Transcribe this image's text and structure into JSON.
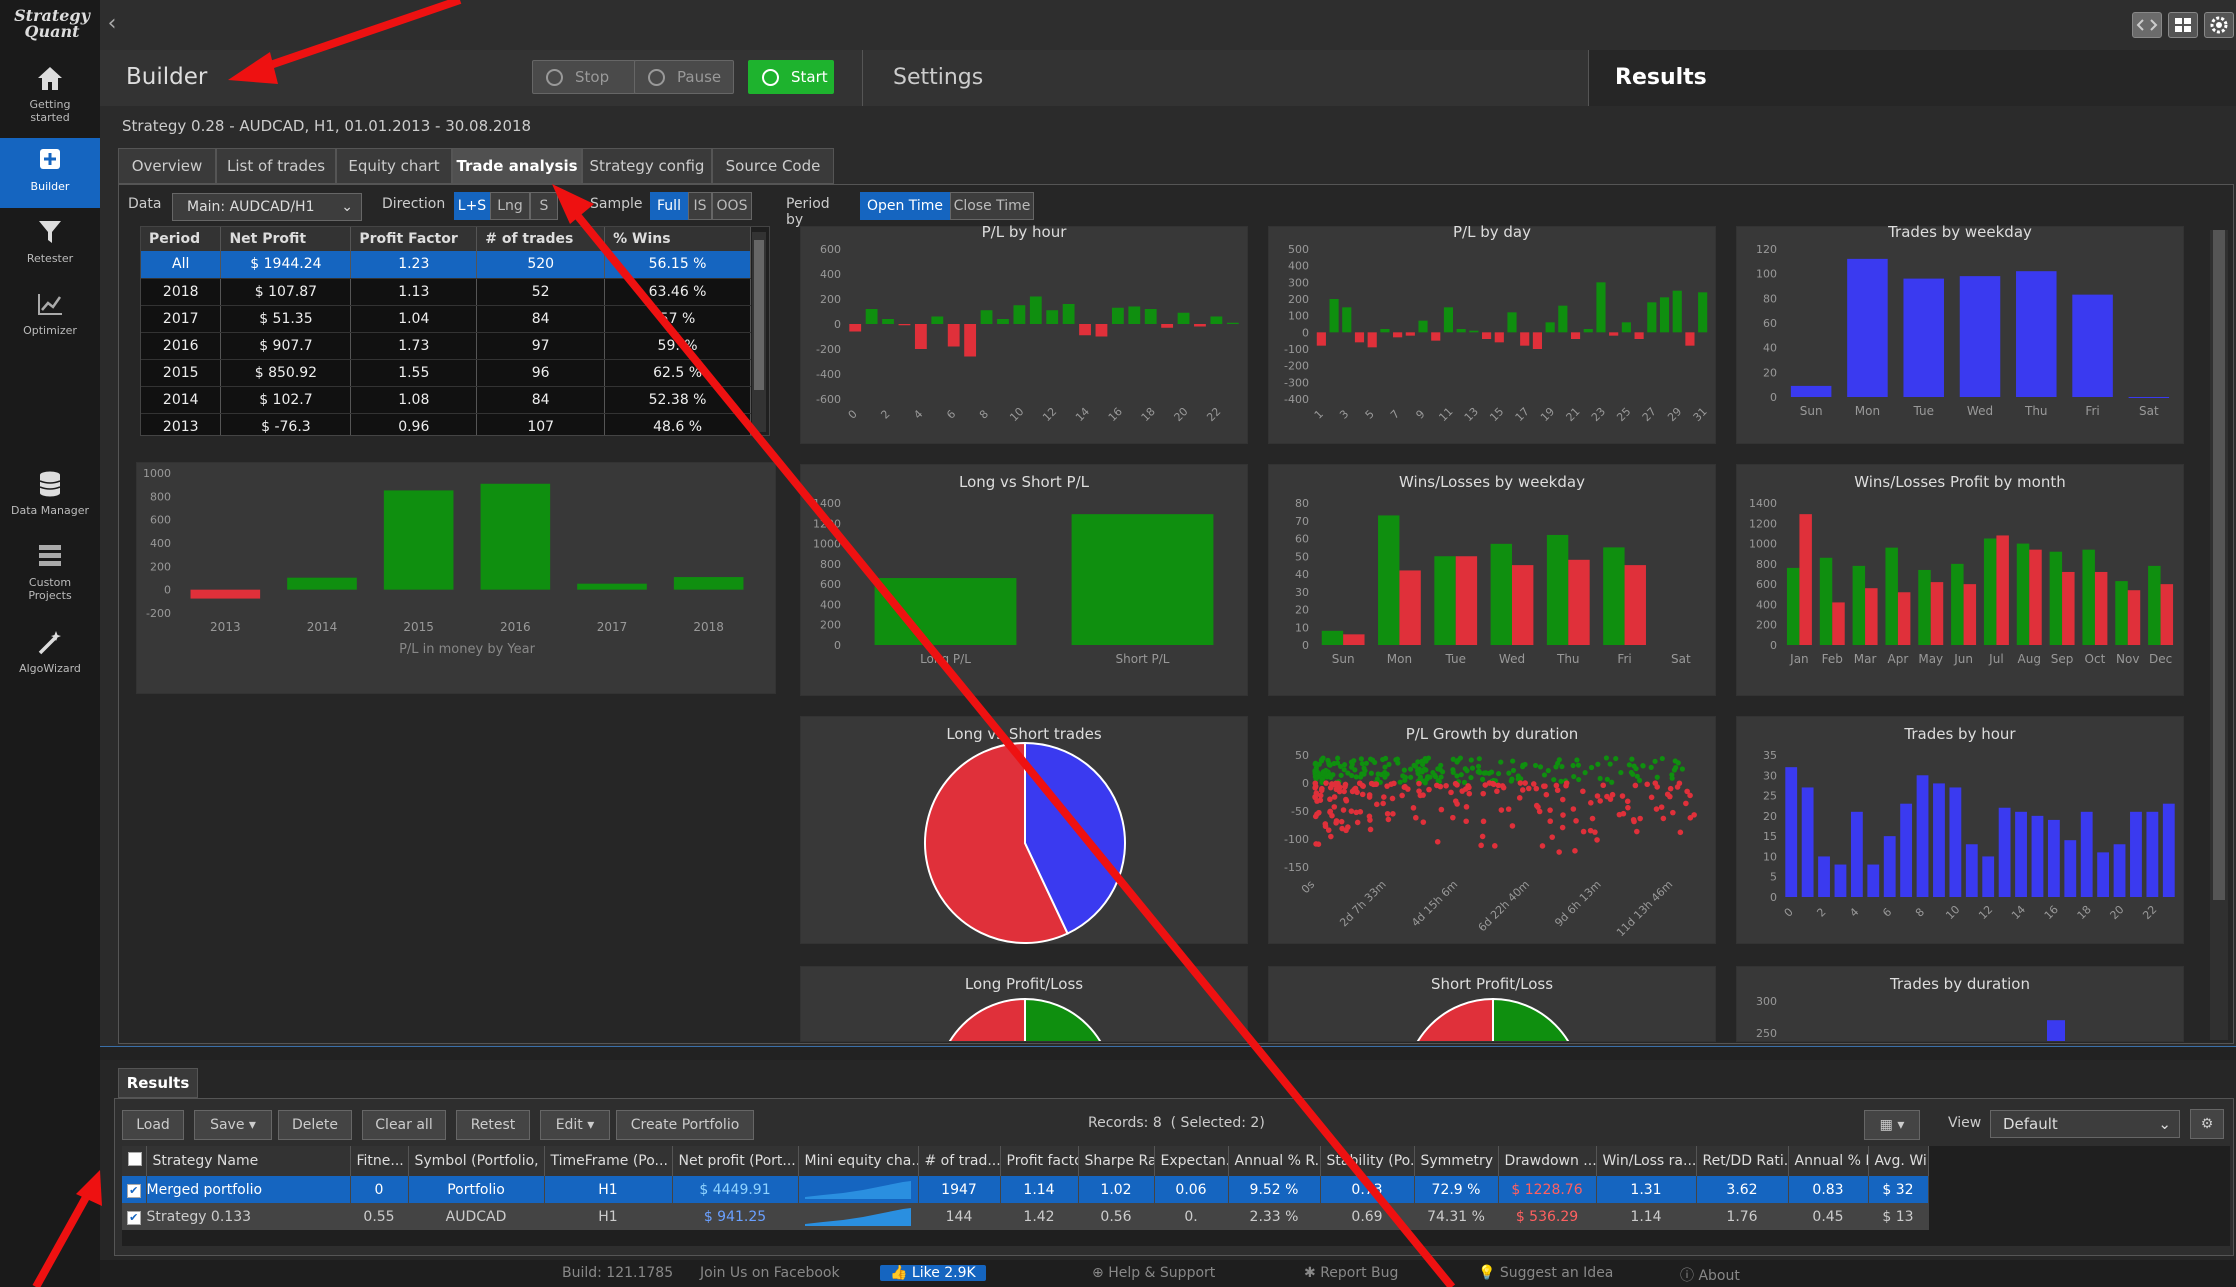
{
  "app": {
    "logo": "Strategy\nQuant"
  },
  "nav": [
    {
      "label": "Getting\nstarted",
      "icon": "home-icon"
    },
    {
      "label": "Builder",
      "icon": "plus-box-icon",
      "active": true
    },
    {
      "label": "Retester",
      "icon": "funnel-icon"
    },
    {
      "label": "Optimizer",
      "icon": "line-chart-icon"
    },
    {
      "label": "Data Manager",
      "icon": "database-icon"
    },
    {
      "label": "Custom\nProjects",
      "icon": "stack-icon"
    },
    {
      "label": "AlgoWizard",
      "icon": "wand-icon"
    }
  ],
  "header": {
    "title": "Builder",
    "stop": "Stop",
    "pause": "Pause",
    "start": "Start",
    "settings_tab": "Settings",
    "results_tab": "Results"
  },
  "strategy_info": "Strategy 0.28 - AUDCAD, H1, 01.01.2013 - 30.08.2018",
  "tabs": [
    "Overview",
    "List of trades",
    "Equity chart",
    "Trade analysis",
    "Strategy config",
    "Source Code"
  ],
  "filters": {
    "data_label": "Data",
    "data_value": "Main: AUDCAD/H1",
    "direction_label": "Direction",
    "direction": [
      "L+S",
      "Lng",
      "S"
    ],
    "sample_label": "Sample",
    "sample": [
      "Full",
      "IS",
      "OOS"
    ],
    "period_label": "Period by",
    "period": [
      "Open Time",
      "Close Time"
    ]
  },
  "year_table": {
    "headers": [
      "Period",
      "Net Profit",
      "Profit Factor",
      "# of trades",
      "% Wins"
    ],
    "rows": [
      [
        "All",
        "$ 1944.24",
        "1.23",
        "520",
        "56.15 %"
      ],
      [
        "2018",
        "$ 107.87",
        "1.13",
        "52",
        "63.46 %"
      ],
      [
        "2017",
        "$ 51.35",
        "1.04",
        "84",
        "57 %"
      ],
      [
        "2016",
        "$ 907.7",
        "1.73",
        "97",
        "59. %"
      ],
      [
        "2015",
        "$ 850.92",
        "1.55",
        "96",
        "62.5 %"
      ],
      [
        "2014",
        "$ 102.7",
        "1.08",
        "84",
        "52.38 %"
      ],
      [
        "2013",
        "$ -76.3",
        "0.96",
        "107",
        "48.6 %"
      ]
    ]
  },
  "chart_data": [
    {
      "id": "pl-by-year",
      "type": "bar",
      "title": "",
      "xlabel": "P/L in money by Year",
      "categories": [
        "2013",
        "2014",
        "2015",
        "2016",
        "2017",
        "2018"
      ],
      "values": [
        -76.3,
        102.7,
        850.92,
        907.7,
        51.35,
        107.87
      ],
      "ylim": [
        -200,
        1000
      ],
      "yticks": [
        -200,
        0,
        200,
        400,
        600,
        800,
        1000
      ],
      "color": "#0f8f0f",
      "neg_color": "#e0303a"
    },
    {
      "id": "pl-by-hour",
      "type": "bar",
      "title": "P/L by hour",
      "categories": [
        "0",
        "1",
        "2",
        "3",
        "4",
        "5",
        "6",
        "7",
        "8",
        "9",
        "10",
        "11",
        "12",
        "13",
        "14",
        "15",
        "16",
        "17",
        "18",
        "19",
        "20",
        "21",
        "22",
        "23"
      ],
      "xticks": [
        "0",
        "2",
        "4",
        "6",
        "8",
        "10",
        "12",
        "14",
        "16",
        "18",
        "20",
        "22"
      ],
      "values": [
        -60,
        120,
        40,
        -10,
        -200,
        60,
        -180,
        -260,
        110,
        40,
        150,
        220,
        110,
        160,
        -90,
        -100,
        130,
        140,
        120,
        -30,
        90,
        -20,
        60,
        10
      ],
      "ylim": [
        -600,
        600
      ],
      "yticks": [
        -600,
        -400,
        -200,
        0,
        200,
        400,
        600
      ]
    },
    {
      "id": "pl-by-day",
      "type": "bar",
      "title": "P/L by day",
      "categories": [
        "1",
        "2",
        "3",
        "4",
        "5",
        "6",
        "7",
        "8",
        "9",
        "10",
        "11",
        "12",
        "13",
        "14",
        "15",
        "16",
        "17",
        "18",
        "19",
        "20",
        "21",
        "22",
        "23",
        "24",
        "25",
        "26",
        "27",
        "28",
        "29",
        "30",
        "31"
      ],
      "xticks": [
        "1",
        "3",
        "5",
        "7",
        "9",
        "11",
        "13",
        "15",
        "17",
        "19",
        "21",
        "23",
        "25",
        "27",
        "29",
        "31"
      ],
      "values": [
        -80,
        200,
        150,
        -60,
        -90,
        20,
        -30,
        -20,
        70,
        -50,
        150,
        20,
        10,
        -40,
        -60,
        120,
        -80,
        -100,
        60,
        160,
        -40,
        20,
        300,
        -20,
        60,
        -40,
        180,
        210,
        250,
        -80,
        240
      ],
      "ylim": [
        -400,
        500
      ],
      "yticks": [
        -400,
        -300,
        -200,
        -100,
        0,
        100,
        200,
        300,
        400,
        500
      ]
    },
    {
      "id": "trades-by-weekday",
      "type": "bar",
      "title": "Trades by weekday",
      "categories": [
        "Sun",
        "Mon",
        "Tue",
        "Wed",
        "Thu",
        "Fri",
        "Sat"
      ],
      "values": [
        9,
        112,
        96,
        98,
        102,
        83,
        0
      ],
      "ylim": [
        0,
        120
      ],
      "yticks": [
        0,
        20,
        40,
        60,
        80,
        100,
        120
      ],
      "color": "#3a3af0"
    },
    {
      "id": "long-vs-short",
      "type": "bar",
      "title": "Long vs Short P/L",
      "categories": [
        "Long P/L",
        "Short P/L"
      ],
      "values": [
        660,
        1290
      ],
      "ylim": [
        0,
        1400
      ],
      "yticks": [
        0,
        200,
        400,
        600,
        800,
        1000,
        1200,
        1400
      ],
      "color": "#0f8f0f"
    },
    {
      "id": "wins-losses-weekday",
      "type": "bar",
      "title": "Wins/Losses by weekday",
      "categories": [
        "Sun",
        "Mon",
        "Tue",
        "Wed",
        "Thu",
        "Fri",
        "Sat"
      ],
      "series": [
        {
          "name": "Wins",
          "values": [
            8,
            73,
            50,
            57,
            62,
            55,
            0
          ]
        },
        {
          "name": "Losses",
          "values": [
            6,
            42,
            50,
            45,
            48,
            45,
            0
          ]
        }
      ],
      "ylim": [
        0,
        80
      ],
      "yticks": [
        0,
        10,
        20,
        30,
        40,
        50,
        60,
        70,
        80
      ],
      "colors": [
        "#0f8f0f",
        "#e0303a"
      ]
    },
    {
      "id": "wins-losses-month",
      "type": "bar",
      "title": "Wins/Losses Profit by month",
      "categories": [
        "Jan",
        "Feb",
        "Mar",
        "Apr",
        "May",
        "Jun",
        "Jul",
        "Aug",
        "Sep",
        "Oct",
        "Nov",
        "Dec"
      ],
      "series": [
        {
          "name": "Wins",
          "values": [
            760,
            860,
            780,
            960,
            740,
            800,
            1050,
            1000,
            920,
            940,
            630,
            780
          ]
        },
        {
          "name": "Losses",
          "values": [
            1290,
            420,
            560,
            520,
            620,
            600,
            1080,
            940,
            720,
            720,
            540,
            600
          ]
        }
      ],
      "ylim": [
        0,
        1400
      ],
      "yticks": [
        0,
        200,
        400,
        600,
        800,
        1000,
        1200,
        1400
      ],
      "colors": [
        "#0f8f0f",
        "#e0303a"
      ]
    },
    {
      "id": "long-short-trades",
      "type": "pie",
      "title": "Long vs Short trades",
      "values": [
        57,
        43
      ],
      "colors": [
        "#e0303a",
        "#3a3af0"
      ]
    },
    {
      "id": "pl-growth-duration",
      "type": "scatter",
      "title": "P/L Growth by duration",
      "xticks": [
        "0s",
        "2d 7h 33m",
        "4d 15h 6m",
        "6d 22h 40m",
        "9d 6h 13m",
        "11d 13h 46m"
      ],
      "ylim": [
        -150,
        50
      ],
      "yticks": [
        -150,
        -100,
        -50,
        0,
        50
      ]
    },
    {
      "id": "trades-by-hour",
      "type": "bar",
      "title": "Trades by hour",
      "categories": [
        "0",
        "1",
        "2",
        "3",
        "4",
        "5",
        "6",
        "7",
        "8",
        "9",
        "10",
        "11",
        "12",
        "13",
        "14",
        "15",
        "16",
        "17",
        "18",
        "19",
        "20",
        "21",
        "22",
        "23"
      ],
      "xticks": [
        "0",
        "2",
        "4",
        "6",
        "8",
        "10",
        "12",
        "14",
        "16",
        "18",
        "20",
        "22"
      ],
      "values": [
        32,
        27,
        10,
        8,
        21,
        8,
        15,
        23,
        30,
        28,
        27,
        13,
        10,
        22,
        21,
        20,
        19,
        14,
        21,
        11,
        13,
        21,
        21,
        23
      ],
      "ylim": [
        0,
        35
      ],
      "yticks": [
        0,
        5,
        10,
        15,
        20,
        25,
        30,
        35
      ],
      "color": "#3a3af0"
    },
    {
      "id": "long-pl",
      "type": "pie",
      "title": "Long Profit/Loss",
      "values": [
        50,
        50
      ],
      "colors": [
        "#e0303a",
        "#0f8f0f"
      ]
    },
    {
      "id": "short-pl",
      "type": "pie",
      "title": "Short Profit/Loss",
      "values": [
        50,
        50
      ],
      "colors": [
        "#e0303a",
        "#0f8f0f"
      ]
    },
    {
      "id": "trades-by-duration",
      "type": "bar",
      "title": "Trades by duration",
      "yticks": [
        200,
        250,
        300
      ],
      "ylim": [
        200,
        300
      ],
      "values": [
        270
      ]
    }
  ],
  "results": {
    "tab": "Results",
    "buttons": [
      "Load",
      "Save",
      "Delete",
      "Clear all",
      "Retest",
      "Edit",
      "Create Portfolio"
    ],
    "records": "Records: 8  ( Selected: 2)",
    "view_label": "View",
    "view_value": "Default",
    "columns": [
      "Strategy Name",
      "Fitne...",
      "Symbol (Portfolio, IS)",
      "TimeFrame (Po...",
      "Net profit (Port...",
      "Mini equity cha...",
      "# of trad...",
      "Profit facto...",
      "Sharpe Rati...",
      "Expectan...",
      "Annual % R...",
      "Stability (Po...",
      "Symmetry (...",
      "Drawdown ...",
      "Win/Loss ra...",
      "Ret/DD Rati...",
      "Annual % R...",
      "Avg. Win ("
    ],
    "rows": [
      [
        "Merged portfolio",
        "0",
        "Portfolio",
        "H1",
        "$ 4449.91",
        "",
        "1947",
        "1.14",
        "1.02",
        "0.06",
        "9.52 %",
        "0.73",
        "72.9 %",
        "$ 1228.76",
        "1.31",
        "3.62",
        "0.83",
        "$ 32"
      ],
      [
        "Strategy 0.133",
        "0.55",
        "AUDCAD",
        "H1",
        "$ 941.25",
        "",
        "144",
        "1.42",
        "0.56",
        "0.",
        "2.33 %",
        "0.69",
        "74.31 %",
        "$ 536.29",
        "1.14",
        "1.76",
        "0.45",
        "$ 13"
      ]
    ]
  },
  "footer": {
    "build": "Build: 121.1785",
    "facebook": "Join Us on Facebook",
    "like": "Like 2.9K",
    "help": "Help & Support",
    "bug": "Report Bug",
    "idea": "Suggest an Idea",
    "about": "About"
  }
}
